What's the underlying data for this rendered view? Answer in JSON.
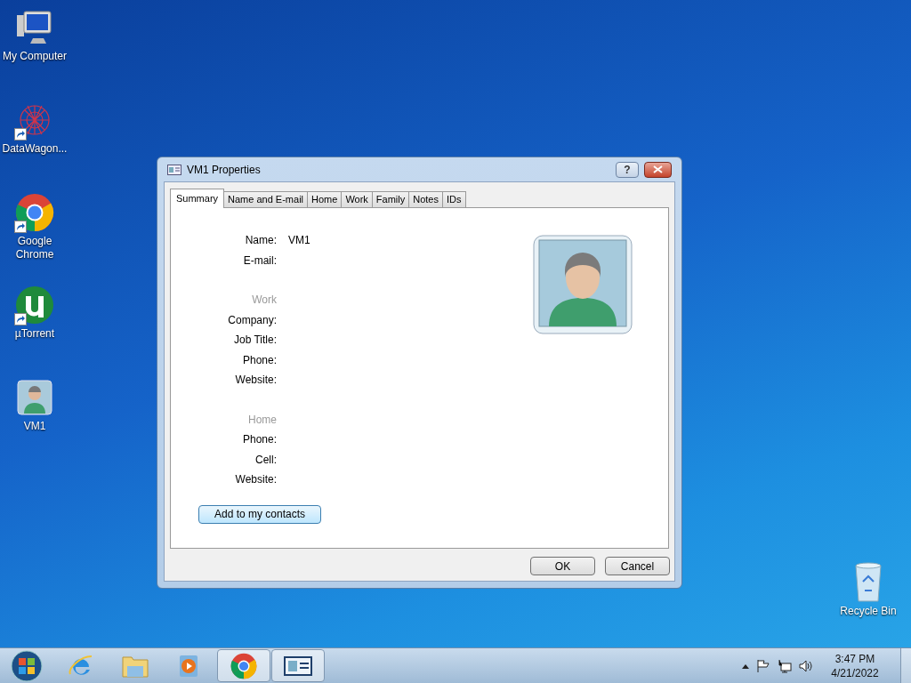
{
  "desktop_icons": [
    {
      "kind": "computer",
      "label": "My Computer",
      "shortcut": false
    },
    {
      "kind": "network",
      "label": "DataWagon...",
      "shortcut": true
    },
    {
      "kind": "chrome",
      "label": "Google Chrome",
      "shortcut": true
    },
    {
      "kind": "utorrent",
      "label": "µTorrent",
      "shortcut": true
    },
    {
      "kind": "contact",
      "label": "VM1",
      "shortcut": false
    }
  ],
  "recycle_bin": {
    "label": "Recycle Bin"
  },
  "dialog": {
    "title": "VM1 Properties",
    "help": "?",
    "tabs": [
      {
        "label": "Summary",
        "selected": true
      },
      {
        "label": "Name and E-mail",
        "selected": false
      },
      {
        "label": "Home",
        "selected": false
      },
      {
        "label": "Work",
        "selected": false
      },
      {
        "label": "Family",
        "selected": false
      },
      {
        "label": "Notes",
        "selected": false
      },
      {
        "label": "IDs",
        "selected": false
      }
    ],
    "rows": [
      {
        "kind": "field",
        "label": "Name:",
        "value": "VM1"
      },
      {
        "kind": "field",
        "label": "E-mail:"
      },
      {
        "kind": "gap"
      },
      {
        "kind": "heading",
        "label": "Work"
      },
      {
        "kind": "field",
        "label": "Company:"
      },
      {
        "kind": "field",
        "label": "Job Title:"
      },
      {
        "kind": "field",
        "label": "Phone:"
      },
      {
        "kind": "field",
        "label": "Website:"
      },
      {
        "kind": "gap"
      },
      {
        "kind": "heading",
        "label": "Home"
      },
      {
        "kind": "field",
        "label": "Phone:"
      },
      {
        "kind": "field",
        "label": "Cell:"
      },
      {
        "kind": "field",
        "label": "Website:"
      }
    ],
    "add_button": "Add to my contacts",
    "buttons": [
      "OK",
      "Cancel"
    ]
  },
  "taskbar": {
    "apps": [
      {
        "kind": "ie",
        "selected": false
      },
      {
        "kind": "explorer",
        "selected": false
      },
      {
        "kind": "media",
        "selected": false
      },
      {
        "kind": "chrome",
        "selected": true
      },
      {
        "kind": "contact-card",
        "selected": true
      }
    ],
    "time": "3:47 PM",
    "date": "4/21/2022"
  }
}
